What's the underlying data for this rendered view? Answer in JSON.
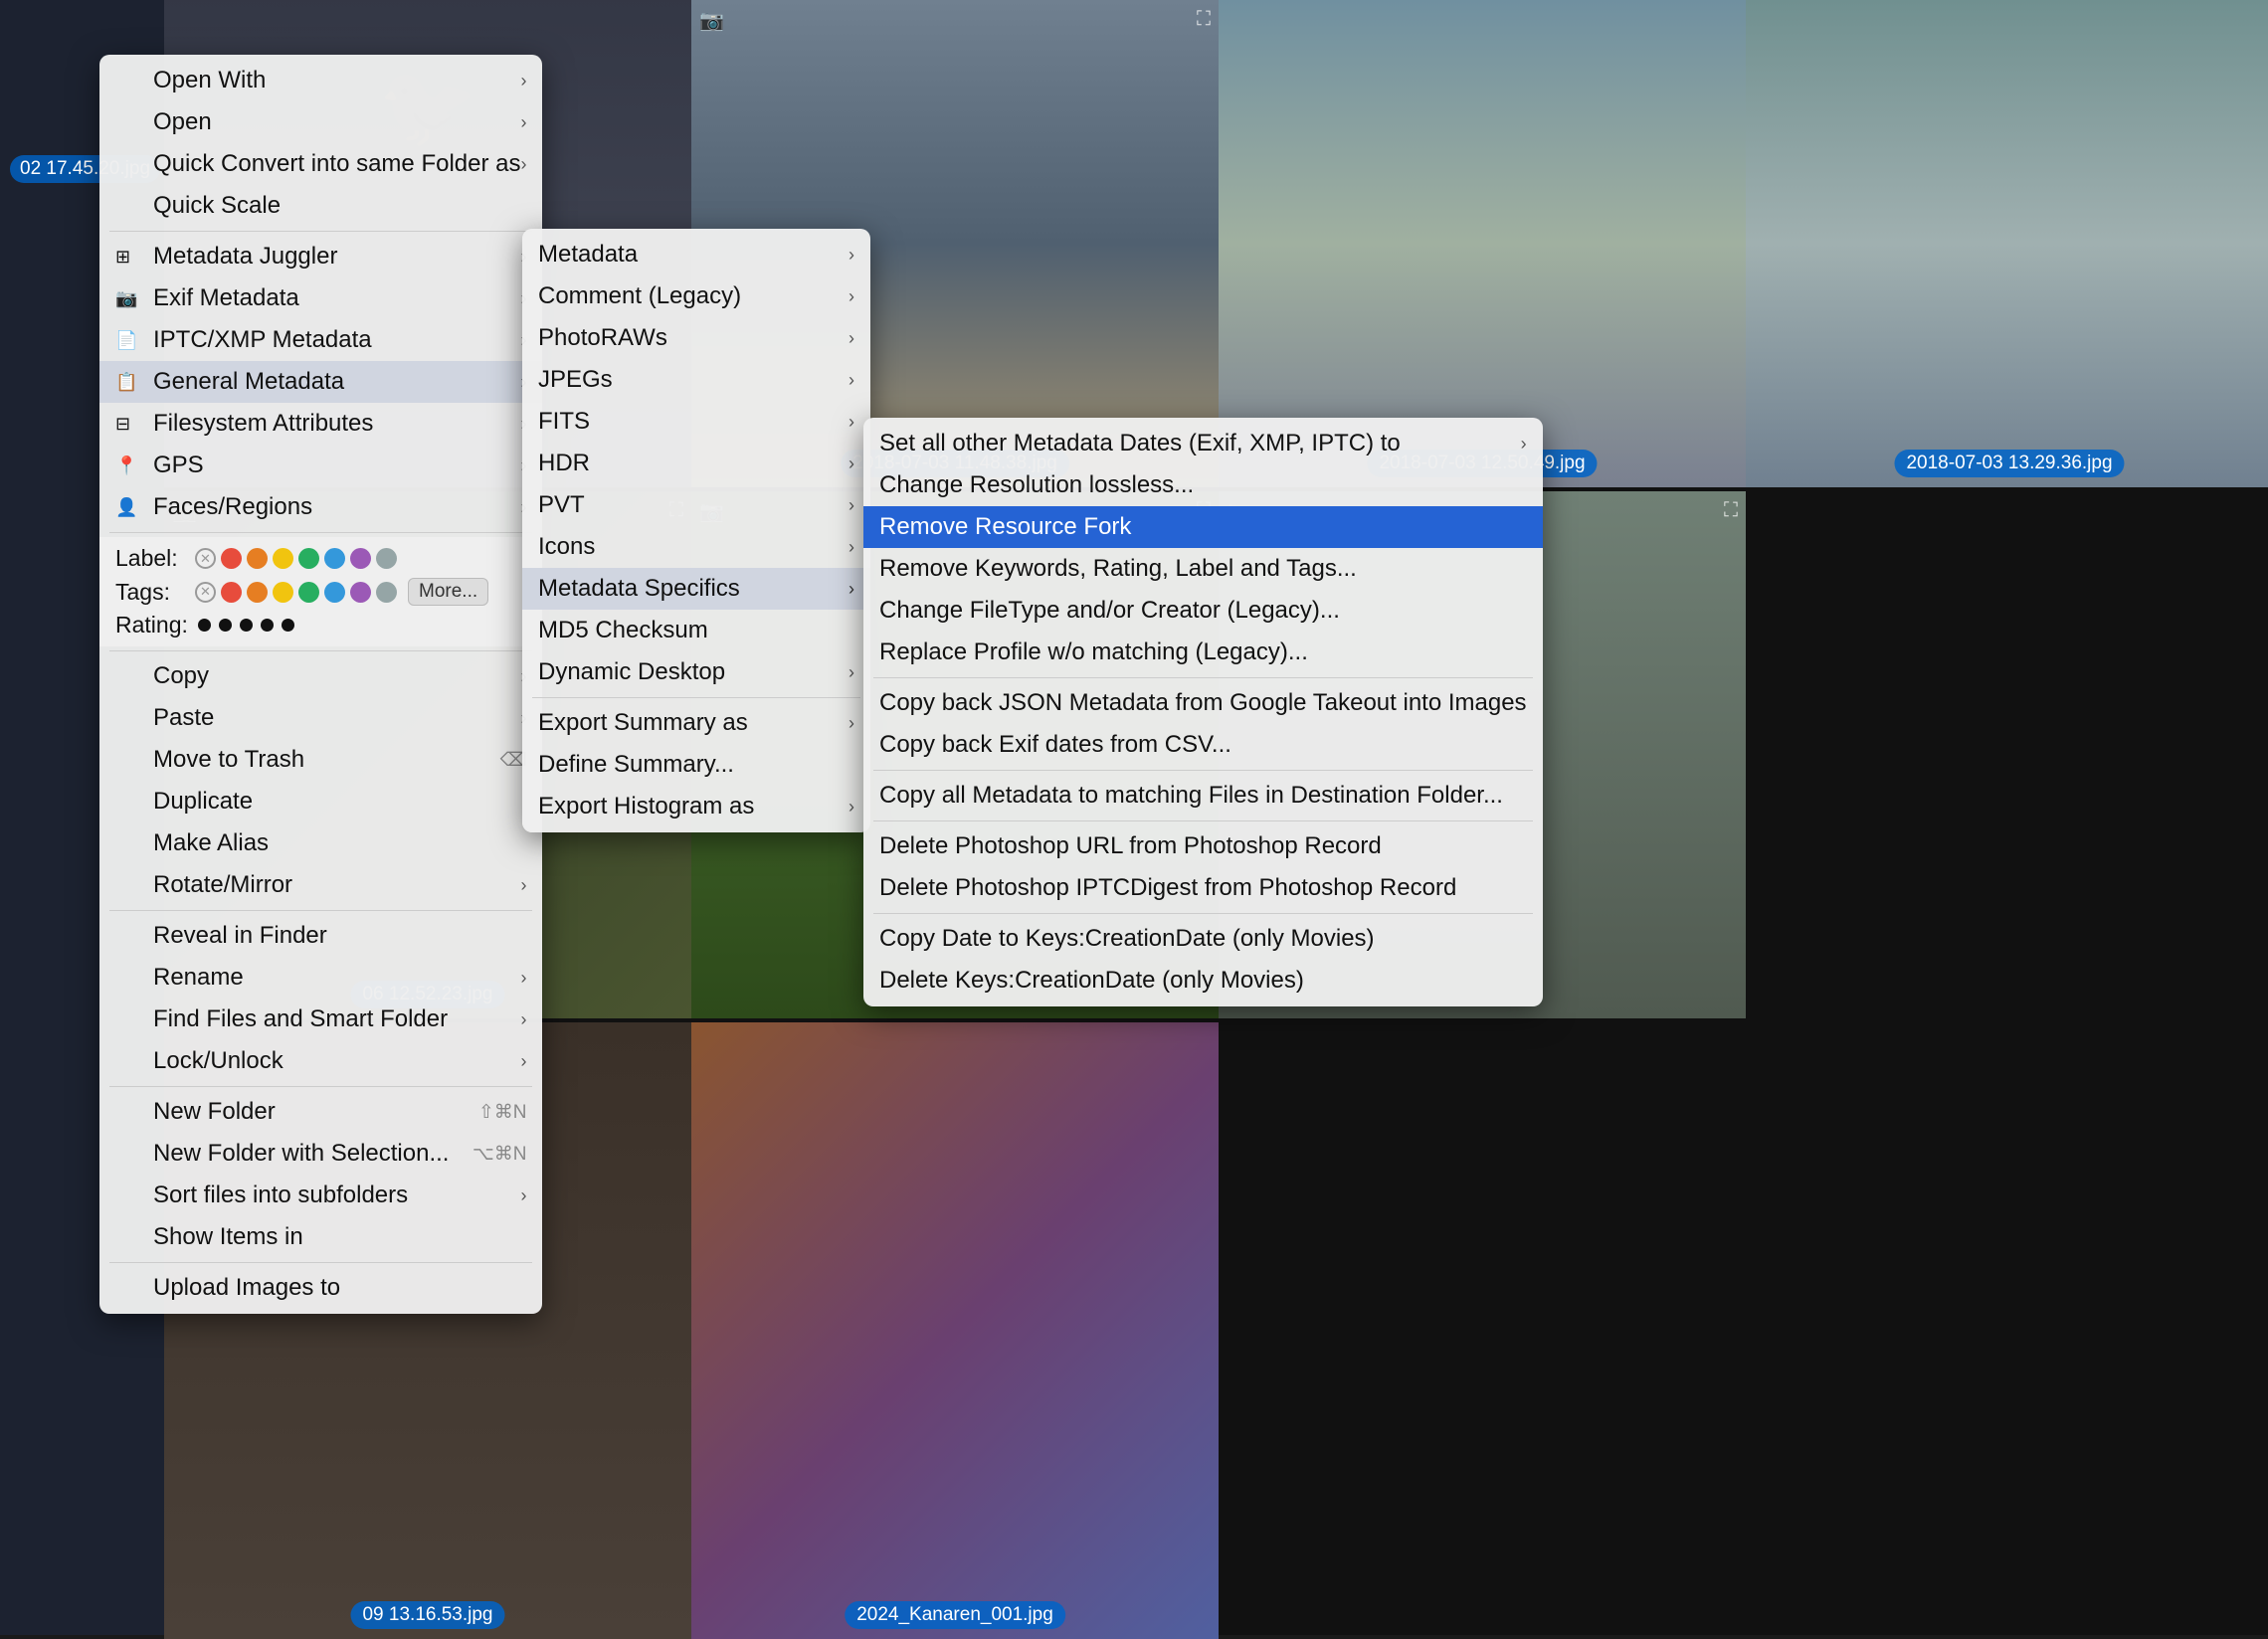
{
  "background": {
    "photos": [
      {
        "id": "p1",
        "label": "02 17.45.20.jpg",
        "bg": "dark-bg"
      },
      {
        "id": "p2",
        "label": "",
        "bg": "sky-bg"
      },
      {
        "id": "p3",
        "label": "2018-07-03 11.48.38.jpg",
        "bg": "bridge-bg"
      },
      {
        "id": "p4",
        "label": "2018-07-03 12.50.49.jpg",
        "bg": "sky-bg"
      },
      {
        "id": "p5",
        "label": "2018-07-03 13.29.36.jpg",
        "bg": "bridge-bg"
      },
      {
        "id": "p6",
        "label": "06 12.52.23.jpg",
        "bg": "green-bg"
      },
      {
        "id": "p7",
        "label": "",
        "bg": "tree-bg"
      },
      {
        "id": "p8",
        "label": "",
        "bg": "castle-bg"
      },
      {
        "id": "p9",
        "label": "09 13.16.53.jpg",
        "bg": "ruin-bg"
      },
      {
        "id": "p10",
        "label": "2024_Kanaren_001.jpg",
        "bg": "colorful-bg"
      }
    ]
  },
  "menu_main": {
    "items": [
      {
        "id": "open-with",
        "label": "Open With",
        "has_arrow": true,
        "icon": ""
      },
      {
        "id": "open",
        "label": "Open",
        "has_arrow": true,
        "icon": ""
      },
      {
        "id": "quick-convert",
        "label": "Quick Convert into same Folder as",
        "has_arrow": true,
        "icon": ""
      },
      {
        "id": "quick-scale",
        "label": "Quick Scale",
        "has_arrow": false,
        "icon": ""
      },
      {
        "id": "sep1",
        "type": "separator"
      },
      {
        "id": "metadata-juggler",
        "label": "Metadata Juggler",
        "has_arrow": true,
        "icon": "grid"
      },
      {
        "id": "exif-metadata",
        "label": "Exif Metadata",
        "has_arrow": true,
        "icon": "camera"
      },
      {
        "id": "iptc-xmp-metadata",
        "label": "IPTC/XMP Metadata",
        "has_arrow": true,
        "icon": "doc"
      },
      {
        "id": "general-metadata",
        "label": "General Metadata",
        "has_arrow": true,
        "icon": "doc2",
        "highlighted": true
      },
      {
        "id": "filesystem-attrs",
        "label": "Filesystem Attributes",
        "has_arrow": true,
        "icon": "grid2"
      },
      {
        "id": "gps",
        "label": "GPS",
        "has_arrow": true,
        "icon": "gps"
      },
      {
        "id": "faces-regions",
        "label": "Faces/Regions",
        "has_arrow": true,
        "icon": "person"
      },
      {
        "id": "sep2",
        "type": "separator"
      },
      {
        "id": "label-section",
        "type": "label-section"
      },
      {
        "id": "sep3",
        "type": "separator"
      },
      {
        "id": "copy",
        "label": "Copy",
        "has_arrow": true,
        "icon": ""
      },
      {
        "id": "paste",
        "label": "Paste",
        "has_arrow": true,
        "icon": ""
      },
      {
        "id": "move-trash",
        "label": "Move to Trash",
        "has_arrow": false,
        "icon": "",
        "shortcut": "⌫"
      },
      {
        "id": "duplicate",
        "label": "Duplicate",
        "has_arrow": false,
        "icon": ""
      },
      {
        "id": "make-alias",
        "label": "Make Alias",
        "has_arrow": false,
        "icon": ""
      },
      {
        "id": "rotate-mirror",
        "label": "Rotate/Mirror",
        "has_arrow": true,
        "icon": ""
      },
      {
        "id": "sep4",
        "type": "separator"
      },
      {
        "id": "reveal-finder",
        "label": "Reveal in Finder",
        "has_arrow": false,
        "icon": ""
      },
      {
        "id": "rename",
        "label": "Rename",
        "has_arrow": true,
        "icon": ""
      },
      {
        "id": "find-files",
        "label": "Find Files and Smart Folder",
        "has_arrow": true,
        "icon": ""
      },
      {
        "id": "lock-unlock",
        "label": "Lock/Unlock",
        "has_arrow": true,
        "icon": ""
      },
      {
        "id": "sep5",
        "type": "separator"
      },
      {
        "id": "new-folder",
        "label": "New Folder",
        "has_arrow": false,
        "icon": "",
        "shortcut": "⇧⌘N"
      },
      {
        "id": "new-folder-sel",
        "label": "New Folder with Selection...",
        "has_arrow": false,
        "icon": "",
        "shortcut": "⌥⌘N"
      },
      {
        "id": "sort-subfolders",
        "label": "Sort files into subfolders",
        "has_arrow": true,
        "icon": ""
      },
      {
        "id": "show-items",
        "label": "Show Items in",
        "has_arrow": false,
        "icon": ""
      },
      {
        "id": "sep6",
        "type": "separator"
      },
      {
        "id": "upload-images",
        "label": "Upload Images to",
        "has_arrow": false,
        "icon": ""
      }
    ],
    "label_section": {
      "label_text": "Label:",
      "tags_text": "Tags:",
      "rating_text": "Rating:",
      "colors": [
        "red",
        "orange",
        "yellow",
        "green",
        "blue",
        "purple",
        "gray"
      ],
      "rating_count": 5,
      "more_button_label": "More..."
    }
  },
  "menu_sub1": {
    "title": "General Metadata submenu",
    "items": [
      {
        "id": "metadata",
        "label": "Metadata",
        "has_arrow": true
      },
      {
        "id": "comment-legacy",
        "label": "Comment (Legacy)",
        "has_arrow": true
      },
      {
        "id": "photoraw",
        "label": "PhotoRAWs",
        "has_arrow": true
      },
      {
        "id": "jpegs",
        "label": "JPEGs",
        "has_arrow": true
      },
      {
        "id": "fits",
        "label": "FITS",
        "has_arrow": true
      },
      {
        "id": "hdr",
        "label": "HDR",
        "has_arrow": true
      },
      {
        "id": "pvt",
        "label": "PVT",
        "has_arrow": true
      },
      {
        "id": "icons",
        "label": "Icons",
        "has_arrow": true
      },
      {
        "id": "metadata-specifics",
        "label": "Metadata Specifics",
        "has_arrow": true,
        "highlighted": true
      },
      {
        "id": "md5-checksum",
        "label": "MD5 Checksum",
        "has_arrow": false
      },
      {
        "id": "dynamic-desktop",
        "label": "Dynamic Desktop",
        "has_arrow": true
      },
      {
        "id": "sep-sub1",
        "type": "separator"
      },
      {
        "id": "export-summary",
        "label": "Export Summary as",
        "has_arrow": true
      },
      {
        "id": "define-summary",
        "label": "Define Summary...",
        "has_arrow": false
      },
      {
        "id": "export-histogram",
        "label": "Export Histogram as",
        "has_arrow": true
      }
    ]
  },
  "menu_sub2": {
    "title": "Metadata Specifics submenu",
    "items": [
      {
        "id": "set-all-dates",
        "label": "Set all other Metadata Dates (Exif, XMP, IPTC) to",
        "has_arrow": true
      },
      {
        "id": "change-resolution",
        "label": "Change Resolution lossless...",
        "has_arrow": false
      },
      {
        "id": "remove-resource-fork",
        "label": "Remove Resource Fork",
        "has_arrow": false,
        "highlighted": true
      },
      {
        "id": "remove-keywords",
        "label": "Remove Keywords, Rating, Label and Tags...",
        "has_arrow": false
      },
      {
        "id": "change-filetype",
        "label": "Change FileType and/or Creator (Legacy)...",
        "has_arrow": false
      },
      {
        "id": "replace-profile",
        "label": "Replace Profile w/o matching (Legacy)...",
        "has_arrow": false
      },
      {
        "id": "sep-sub2a",
        "type": "separator"
      },
      {
        "id": "copy-json",
        "label": "Copy back JSON Metadata from Google Takeout into Images",
        "has_arrow": false
      },
      {
        "id": "copy-exif-csv",
        "label": "Copy back Exif dates from CSV...",
        "has_arrow": false
      },
      {
        "id": "sep-sub2b",
        "type": "separator"
      },
      {
        "id": "copy-metadata-dest",
        "label": "Copy all Metadata to matching Files in Destination Folder...",
        "has_arrow": false
      },
      {
        "id": "sep-sub2c",
        "type": "separator"
      },
      {
        "id": "delete-photoshop-url",
        "label": "Delete Photoshop URL from Photoshop Record",
        "has_arrow": false
      },
      {
        "id": "delete-photoshop-iptc",
        "label": "Delete Photoshop IPTCDigest from Photoshop Record",
        "has_arrow": false
      },
      {
        "id": "sep-sub2d",
        "type": "separator"
      },
      {
        "id": "copy-date-keys",
        "label": "Copy Date to Keys:CreationDate (only Movies)",
        "has_arrow": false
      },
      {
        "id": "delete-keys-creation",
        "label": "Delete Keys:CreationDate (only Movies)",
        "has_arrow": false
      }
    ]
  },
  "colors": {
    "accent_blue": "#2563d4",
    "menu_bg": "rgba(235,235,235,0.97)",
    "separator": "#ccc",
    "label_red": "#e74c3c",
    "label_orange": "#e67e22",
    "label_yellow": "#f1c40f",
    "label_green": "#27ae60",
    "label_blue": "#3498db",
    "label_purple": "#9b59b6",
    "label_gray": "#95a5a6"
  }
}
